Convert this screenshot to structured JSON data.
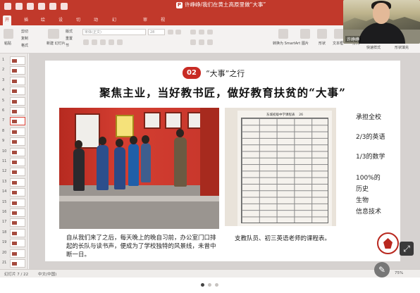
{
  "window": {
    "title": "许峥峥/我们在黄土高原里做“大事”"
  },
  "ribbon": {
    "tabs": [
      "开始",
      "插入",
      "绘图",
      "设计",
      "切换",
      "动画",
      "幻灯片放映",
      "审阅",
      "视图"
    ],
    "font_placeholder": "宋体(正文)",
    "font_size": "28",
    "paste_label": "粘贴",
    "cut_label": "剪切",
    "copy_label": "复制",
    "format_label": "格式",
    "new_slide_label": "新建\n幻灯片",
    "layout_label": "版式",
    "reset_label": "重置",
    "section_label": "节",
    "convert_label": "转换为\nSmartArt",
    "picture_label": "图片",
    "shape_label": "形状",
    "textbox_label": "文本框",
    "arrange_label": "排列",
    "quick_style_label": "快速样式",
    "shape_fill_label": "形状填充"
  },
  "webcam": {
    "name": "许峥峥"
  },
  "thumbnails": [
    "1",
    "2",
    "3",
    "4",
    "5",
    "6",
    "7",
    "8",
    "9",
    "10",
    "11",
    "12",
    "13",
    "14",
    "15",
    "16",
    "17",
    "18",
    "19",
    "20",
    "21"
  ],
  "active_thumbnail": "7",
  "slide": {
    "number_badge": "02",
    "section_title": "“大事”之行",
    "headline": "聚焦主业，当好教书匠，做好教育扶贫的“大事”",
    "table_title": "东城初级中学课程表",
    "table_number": "26",
    "right_list": [
      "承担全校",
      "2/3的英语",
      "1/3的数学",
      "100%的",
      "历史",
      "生物",
      "信息技术"
    ],
    "caption_left": "自从我们来了之后，每天晚上的晚自习前，办公室门口排起的长队与读书声，便成为了学校独特的风景线，未曾中断一日。",
    "caption_right": "支教队员、初三英语老师的课程表。"
  },
  "statusbar": {
    "slide_info": "幻灯片 7 / 22",
    "language": "中文(中国)",
    "zoom": "75%"
  },
  "icons": {
    "expand": "expand-icon",
    "mic": "mic-icon"
  },
  "colors": {
    "accent": "#c82b24",
    "titlebar": "#c1392b"
  }
}
